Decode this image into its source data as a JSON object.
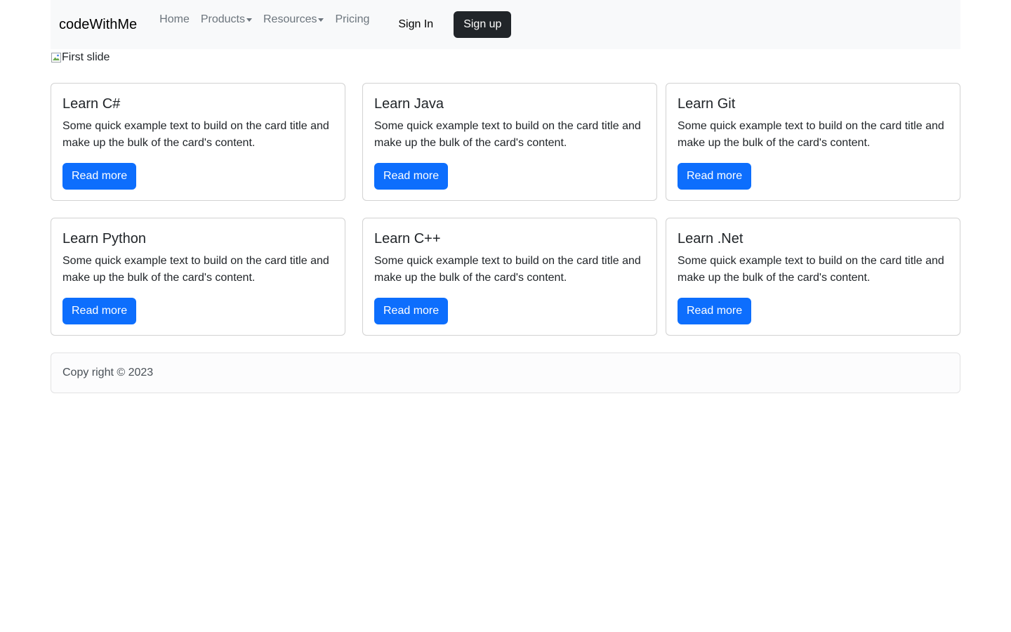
{
  "navbar": {
    "brand": "codeWithMe",
    "links": [
      {
        "label": "Home",
        "dropdown": false
      },
      {
        "label": "Products",
        "dropdown": true
      },
      {
        "label": "Resources",
        "dropdown": true
      },
      {
        "label": "Pricing",
        "dropdown": false
      }
    ],
    "sign_in": "Sign In",
    "sign_up": "Sign up"
  },
  "carousel": {
    "slide_alt": "First slide"
  },
  "cards": [
    {
      "title": "Learn C#",
      "text": "Some quick example text to build on the card title and make up the bulk of the card's content.",
      "button": "Read more"
    },
    {
      "title": "Learn Java",
      "text": "Some quick example text to build on the card title and make up the bulk of the card's content.",
      "button": "Read more"
    },
    {
      "title": "Learn Git",
      "text": "Some quick example text to build on the card title and make up the bulk of the card's content.",
      "button": "Read more"
    },
    {
      "title": "Learn Python",
      "text": "Some quick example text to build on the card title and make up the bulk of the card's content.",
      "button": "Read more"
    },
    {
      "title": "Learn C++",
      "text": "Some quick example text to build on the card title and make up the bulk of the card's content.",
      "button": "Read more"
    },
    {
      "title": "Learn .Net",
      "text": "Some quick example text to build on the card title and make up the bulk of the card's content.",
      "button": "Read more"
    }
  ],
  "footer": {
    "copyright": "Copy right © 2023"
  },
  "colors": {
    "primary": "#0d6efd",
    "dark": "#212529",
    "navbar_bg": "#f8f9fa",
    "muted": "#6c757d"
  }
}
